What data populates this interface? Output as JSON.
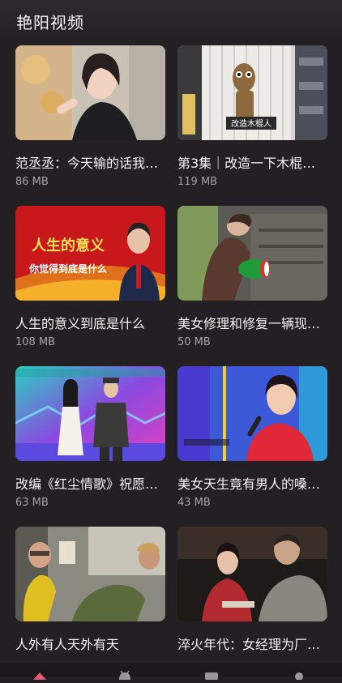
{
  "app": {
    "title": "艳阳视频"
  },
  "videos": [
    {
      "title": "范丞丞：今天输的话我…",
      "size": "86 MB"
    },
    {
      "title": "第3集｜改造一下木棍…",
      "size": "119 MB",
      "overlay_text": "改造木棍人"
    },
    {
      "title": "人生的意义到底是什么",
      "size": "108 MB",
      "overlay_line1": "人生的意义",
      "overlay_line2": "你觉得到底是什么"
    },
    {
      "title": "美女修理和修复一辆现…",
      "size": "50 MB"
    },
    {
      "title": "改编《红尘情歌》祝愿…",
      "size": "63 MB"
    },
    {
      "title": "美女天生竟有男人的嗓…",
      "size": "43 MB"
    },
    {
      "title": "人外有人天外有天",
      "size": ""
    },
    {
      "title": "淬火年代：女经理为厂…",
      "size": ""
    }
  ],
  "nav": [
    {
      "icon": "home-icon",
      "color": "#e8587a"
    },
    {
      "icon": "android-icon",
      "color": "#9a9699"
    },
    {
      "icon": "video-icon",
      "color": "#9a9699"
    },
    {
      "icon": "profile-icon",
      "color": "#9a9699"
    }
  ]
}
